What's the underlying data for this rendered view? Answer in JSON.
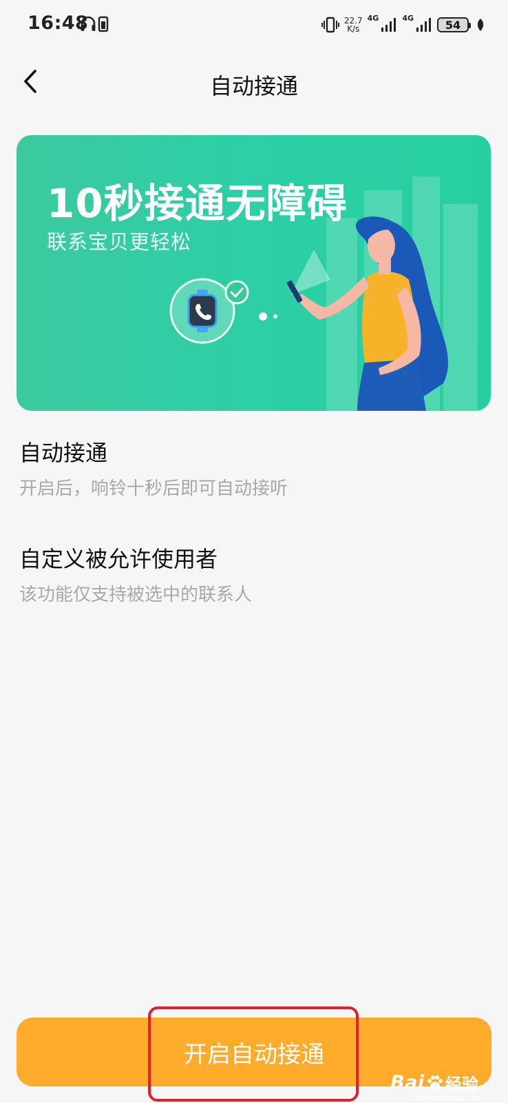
{
  "status_bar": {
    "time": "16:48",
    "net_speed_value": "22.7",
    "net_speed_unit": "K/s",
    "signal1_label": "4G",
    "signal2_label": "4G",
    "battery": "54"
  },
  "nav": {
    "title": "自动接通"
  },
  "banner": {
    "title": "10秒接通无障碍",
    "subtitle": "联系宝贝更轻松"
  },
  "options": [
    {
      "title": "自动接通",
      "desc": "开启后，响铃十秒后即可自动接听"
    },
    {
      "title": "自定义被允许使用者",
      "desc": "该功能仅支持被选中的联系人"
    }
  ],
  "primary_button": {
    "label": "开启自动接通"
  },
  "watermark": {
    "brand": "Bai",
    "brand2": "du",
    "suffix": "经验",
    "url": "jingyan.baidu.com"
  },
  "colors": {
    "accent": "#ffac2c",
    "banner": "#2ccfa6",
    "highlight": "#e0202c"
  }
}
